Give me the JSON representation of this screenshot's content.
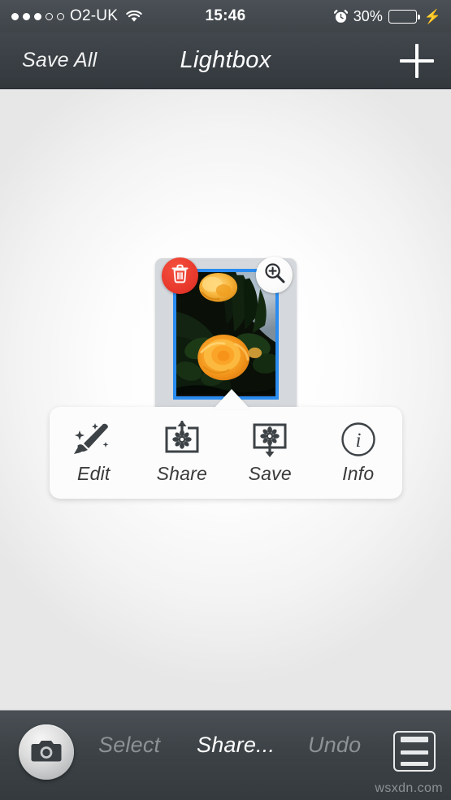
{
  "status_bar": {
    "carrier": "O2-UK",
    "signal_dots_total": 5,
    "signal_dots_filled": 3,
    "wifi_icon": "wifi-icon",
    "time": "15:46",
    "alarm_icon": "alarm-clock-icon",
    "battery_percent": "30%",
    "battery_level": 30,
    "battery_color": "#4cd54c",
    "charging_icon": "lightning-bolt-icon"
  },
  "nav_bar": {
    "left_button": "Save All",
    "title": "Lightbox",
    "add_icon": "plus-icon"
  },
  "thumbnail": {
    "delete_icon": "trash-icon",
    "zoom_icon": "magnifier-plus-icon",
    "photo_alt": "yellow rose flower photo",
    "selection_border_color": "#2a8cf0",
    "card_color": "#d5d8dc"
  },
  "action_popover": {
    "actions": [
      {
        "label": "Edit",
        "icon": "paintbrush-sparkle-icon"
      },
      {
        "label": "Share",
        "icon": "share-upload-icon"
      },
      {
        "label": "Save",
        "icon": "save-download-icon"
      },
      {
        "label": "Info",
        "icon": "info-circle-icon"
      }
    ]
  },
  "toolbar": {
    "camera_icon": "camera-icon",
    "select_label": "Select",
    "share_label": "Share...",
    "undo_label": "Undo",
    "menu_icon": "hamburger-menu-icon",
    "active_item": "Share...",
    "active_color": "#ffffff",
    "disabled_color": "#8d9296"
  },
  "watermark": {
    "text": "wsxdn.com"
  }
}
